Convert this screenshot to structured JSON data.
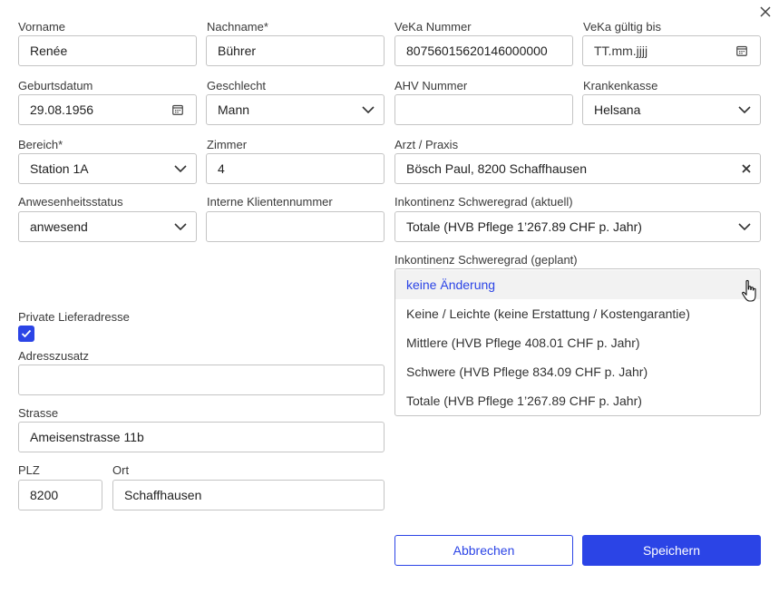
{
  "dialog": {
    "close_icon": "close-icon"
  },
  "fields": {
    "vorname": {
      "label": "Vorname",
      "value": "Renée"
    },
    "nachname": {
      "label": "Nachname*",
      "value": "Bührer"
    },
    "veka_nummer": {
      "label": "VeKa Nummer",
      "value": "80756015620146000000"
    },
    "veka_gueltig": {
      "label": "VeKa gültig bis",
      "placeholder": "TT.mm.jjjj"
    },
    "geburtsdatum": {
      "label": "Geburtsdatum",
      "value": "29.08.1956"
    },
    "geschlecht": {
      "label": "Geschlecht",
      "value": "Mann"
    },
    "ahv_nummer": {
      "label": "AHV Nummer",
      "value": ""
    },
    "krankenkasse": {
      "label": "Krankenkasse",
      "value": "Helsana"
    },
    "bereich": {
      "label": "Bereich*",
      "value": "Station 1A"
    },
    "zimmer": {
      "label": "Zimmer",
      "value": "4"
    },
    "arzt": {
      "label": "Arzt / Praxis",
      "value": "Bösch Paul, 8200 Schaffhausen"
    },
    "anwesenheit": {
      "label": "Anwesenheitsstatus",
      "value": "anwesend"
    },
    "klientennummer": {
      "label": "Interne Klientennummer",
      "value": ""
    },
    "inkontinenz_aktuell": {
      "label": "Inkontinenz Schweregrad (aktuell)",
      "value": "Totale (HVB Pflege 1’267.89 CHF p. Jahr)"
    },
    "inkontinenz_geplant": {
      "label": "Inkontinenz Schweregrad (geplant)",
      "options": [
        "keine Änderung",
        "Keine / Leichte (keine Erstattung / Kostengarantie)",
        "Mittlere (HVB Pflege 408.01 CHF p. Jahr)",
        "Schwere (HVB Pflege 834.09 CHF p. Jahr)",
        "Totale (HVB Pflege 1’267.89 CHF p. Jahr)"
      ],
      "highlighted_index": 0
    },
    "private_lieferadresse": {
      "label": "Private Lieferadresse",
      "checked": true
    },
    "adresszusatz": {
      "label": "Adresszusatz",
      "value": ""
    },
    "strasse": {
      "label": "Strasse",
      "value": "Ameisenstrasse 11b"
    },
    "plz": {
      "label": "PLZ",
      "value": "8200"
    },
    "ort": {
      "label": "Ort",
      "value": "Schaffhausen"
    }
  },
  "buttons": {
    "cancel": "Abbrechen",
    "save": "Speichern"
  },
  "colors": {
    "accent": "#2b44e6",
    "border": "#c4c4c4",
    "highlight_bg": "#f2f2f2"
  }
}
